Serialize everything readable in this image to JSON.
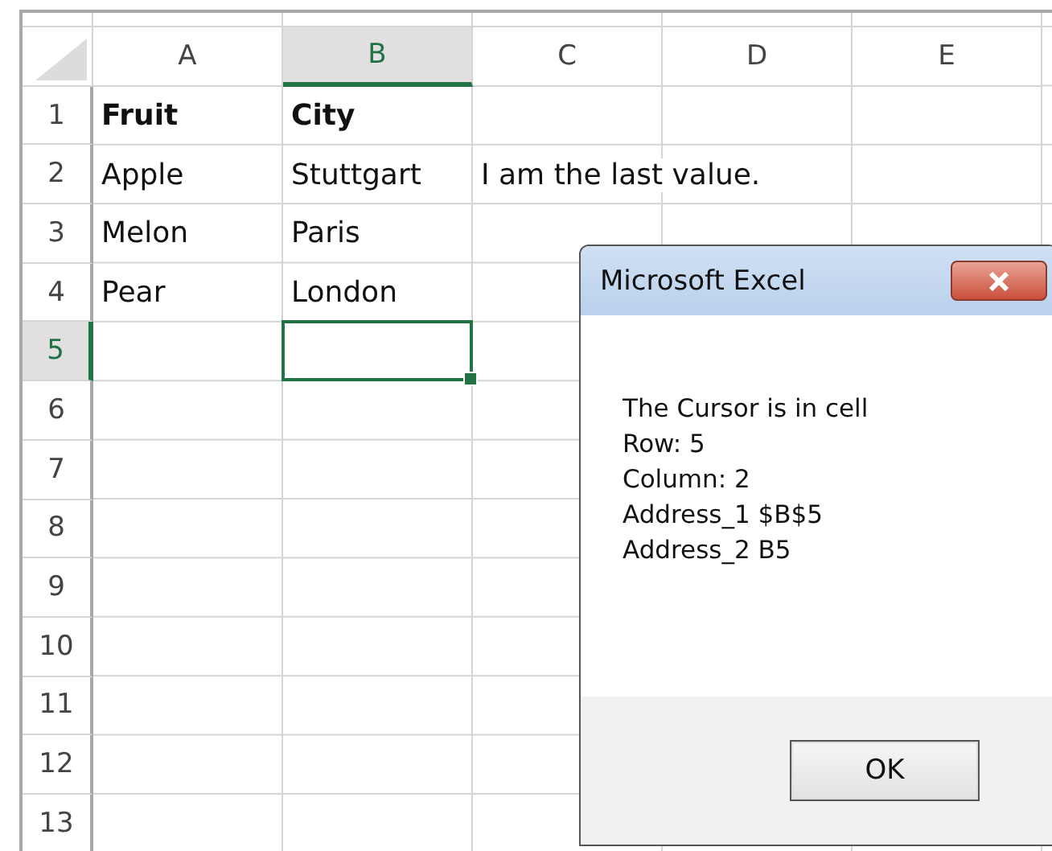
{
  "columns": [
    {
      "label": "A",
      "selected": false
    },
    {
      "label": "B",
      "selected": true
    },
    {
      "label": "C",
      "selected": false
    },
    {
      "label": "D",
      "selected": false
    },
    {
      "label": "E",
      "selected": false
    }
  ],
  "rows": [
    {
      "label": "1",
      "selected": false,
      "cells": [
        {
          "text": "Fruit",
          "bold": true
        },
        {
          "text": "City",
          "bold": true
        }
      ]
    },
    {
      "label": "2",
      "selected": false,
      "cells": [
        {
          "text": "Apple",
          "bold": false
        },
        {
          "text": "Stuttgart",
          "bold": false
        },
        {
          "text": "I am the last value.",
          "bold": false
        }
      ]
    },
    {
      "label": "3",
      "selected": false,
      "cells": [
        {
          "text": "Melon",
          "bold": false
        },
        {
          "text": "Paris",
          "bold": false
        }
      ]
    },
    {
      "label": "4",
      "selected": false,
      "cells": [
        {
          "text": "Pear",
          "bold": false
        },
        {
          "text": "London",
          "bold": false
        }
      ]
    },
    {
      "label": "5",
      "selected": true
    },
    {
      "label": "6",
      "selected": false
    },
    {
      "label": "7",
      "selected": false
    },
    {
      "label": "8",
      "selected": false
    },
    {
      "label": "9",
      "selected": false
    },
    {
      "label": "10",
      "selected": false
    },
    {
      "label": "11",
      "selected": false
    },
    {
      "label": "12",
      "selected": false
    },
    {
      "label": "13",
      "selected": false
    }
  ],
  "dialog": {
    "title": "Microsoft Excel",
    "message": [
      "The Cursor is in cell",
      "Row: 5",
      "Column: 2",
      "Address_1 $B$5",
      "Address_2 B5"
    ],
    "button": "OK"
  }
}
